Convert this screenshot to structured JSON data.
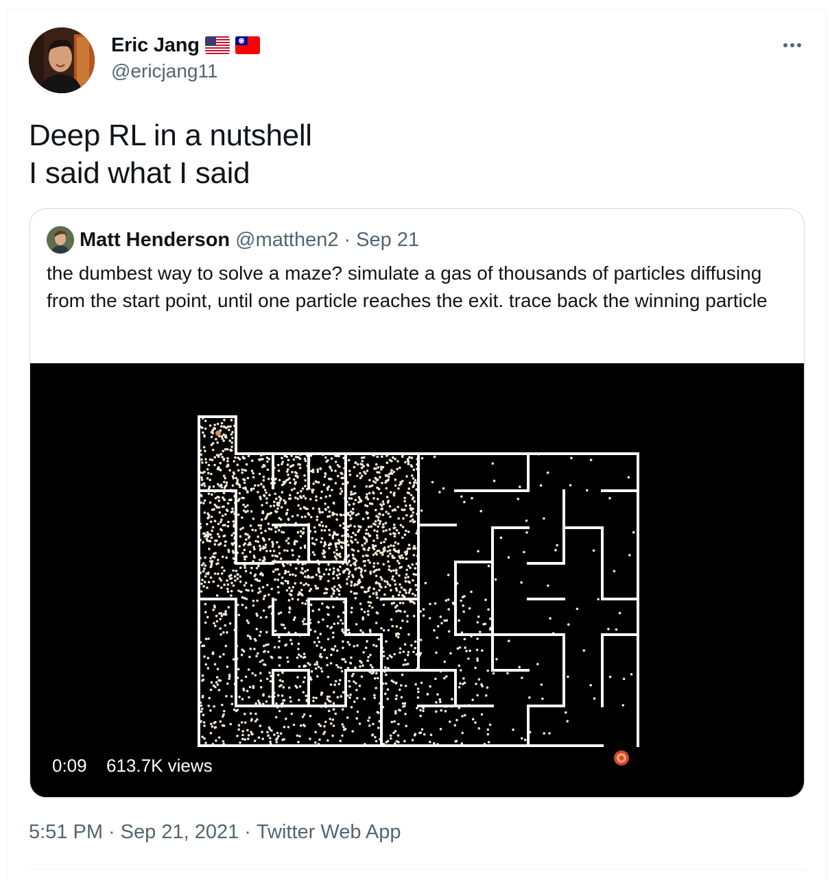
{
  "tweet": {
    "author": {
      "display_name": "Eric Jang",
      "handle": "@ericjang11",
      "flags": [
        "us-flag-icon",
        "taiwan-flag-icon"
      ]
    },
    "text_lines": [
      "Deep RL in a nutshell",
      "I said what I said"
    ],
    "footer": {
      "time": "5:51 PM",
      "date": "Sep 21, 2021",
      "source": "Twitter Web App",
      "separator": "·"
    }
  },
  "quoted_tweet": {
    "author": {
      "display_name": "Matt Henderson",
      "handle": "@matthen2"
    },
    "separator": "·",
    "date": "Sep 21",
    "text": "the dumbest way to solve a maze? simulate a gas of thousands of particles diffusing from the start point, until one particle reaches the exit. trace back the winning particle",
    "video": {
      "elapsed": "0:09",
      "views": "613.7K views"
    }
  },
  "colors": {
    "text_primary": "#0f1419",
    "text_secondary": "#536471",
    "border": "#cfd9de",
    "exit_marker": "#e0543c"
  }
}
